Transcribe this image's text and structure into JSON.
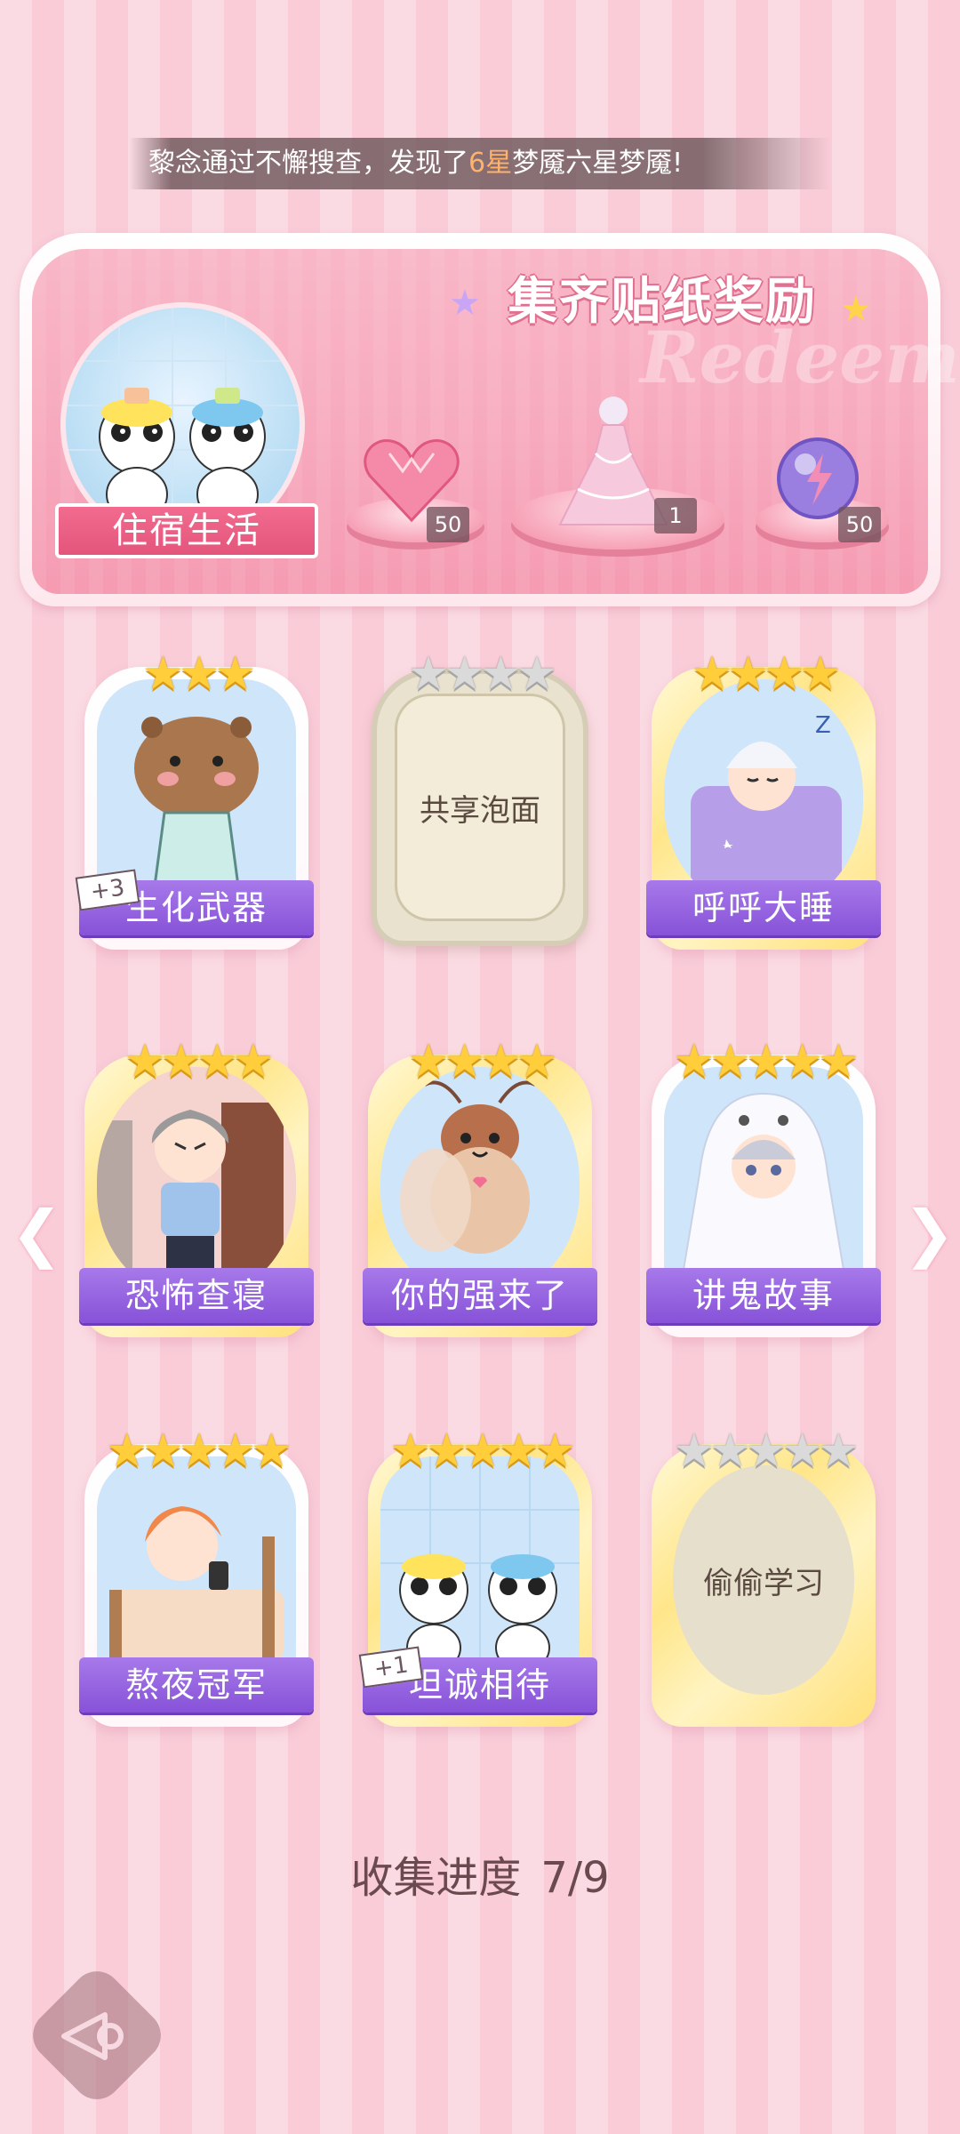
{
  "notice": {
    "prefix": "黎念通过不懈搜查，发现了",
    "highlight": "6星",
    "suffix": "梦魇六星梦魇!"
  },
  "banner": {
    "title": "集齐贴纸奖励",
    "watermark": "Redeem",
    "theme_label": "住宿生活",
    "rewards": [
      {
        "name": "heart-gem",
        "count": "50"
      },
      {
        "name": "dress-outfit",
        "count": "1"
      },
      {
        "name": "energy-orb",
        "count": "50"
      }
    ]
  },
  "stickers": [
    {
      "label": "生化武器",
      "stars": 3,
      "unlocked": true,
      "plus": "+3"
    },
    {
      "label": "共享泡面",
      "stars": 4,
      "unlocked": false
    },
    {
      "label": "呼呼大睡",
      "stars": 4,
      "unlocked": true
    },
    {
      "label": "恐怖查寝",
      "stars": 4,
      "unlocked": true
    },
    {
      "label": "你的强来了",
      "stars": 4,
      "unlocked": true
    },
    {
      "label": "讲鬼故事",
      "stars": 5,
      "unlocked": true
    },
    {
      "label": "熬夜冠军",
      "stars": 5,
      "unlocked": true
    },
    {
      "label": "坦诚相待",
      "stars": 5,
      "unlocked": true,
      "plus": "+1"
    },
    {
      "label": "偷偷学习",
      "stars": 5,
      "unlocked": false
    }
  ],
  "progress": {
    "label": "收集进度",
    "value": "7/9"
  },
  "colors": {
    "accent_pink": "#f26b8f",
    "label_purple": "#8752d8",
    "gold_star": "#ffce3a"
  }
}
